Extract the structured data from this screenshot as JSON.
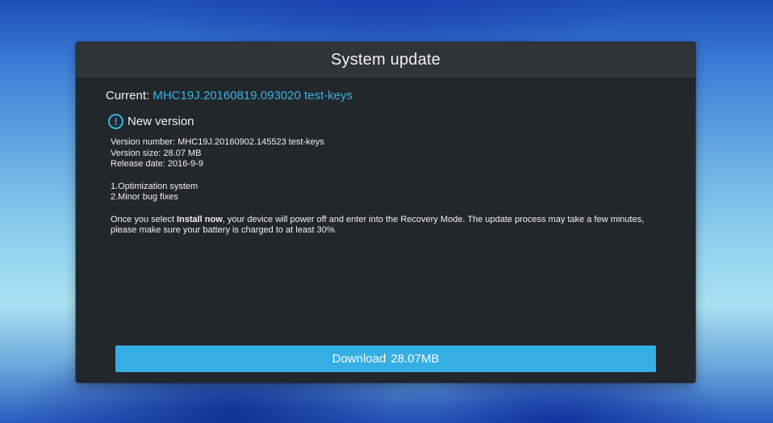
{
  "dialog": {
    "title": "System update",
    "current_label": "Current: ",
    "current_value": "MHC19J.20160819.093020 test-keys",
    "new_version_label": "New version",
    "version_number": "Version number: MHC19J.20160902.145523 test-keys",
    "version_size": "Version size: 28.07 MB",
    "release_date": "Release date: 2016-9-9",
    "changes": [
      "1.Optimization system",
      "2.Minor bug fixes"
    ],
    "notice_prefix": "Once you select ",
    "notice_bold": "Install now",
    "notice_suffix": ", your device will power off and enter into the Recovery Mode. The update process may take a few minutes, please make sure your battery is charged to at least 30%.",
    "download_label": "Download",
    "download_size": "28.07MB"
  },
  "icons": {
    "info": "info-icon"
  },
  "colors": {
    "accent": "#39b2e6",
    "button": "#35aee3",
    "dialog_bg": "#22272b",
    "header_bg": "#2e3438"
  }
}
